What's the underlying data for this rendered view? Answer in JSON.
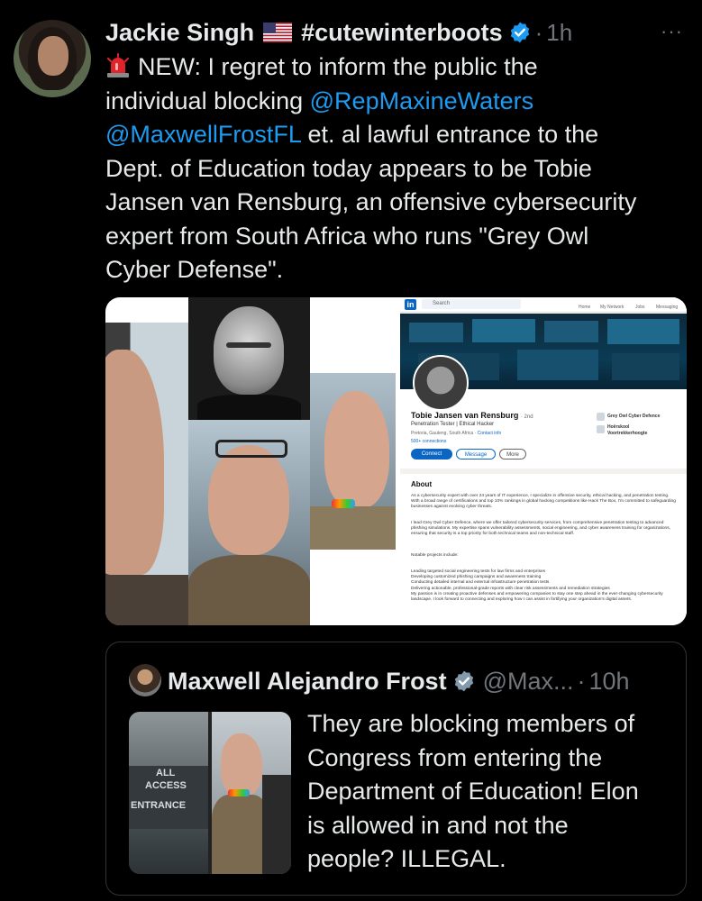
{
  "tweet": {
    "author_name": "Jackie Singh",
    "author_flag": "us-flag-icon",
    "author_hashtag": "#cutewinterboots",
    "separator": "·",
    "time": "1h",
    "more": "···",
    "text_lines": [
      {
        "pre": "NEW: I regret to inform the public the"
      },
      {
        "pre": "individual blocking ",
        "mention": "@RepMaxineWaters"
      },
      {
        "mention": "@MaxwellFrostFL",
        "post": " et. al lawful entrance to the"
      },
      {
        "pre": "Dept. of Education today appears to be Tobie"
      },
      {
        "pre": "Jansen van Rensburg, an offensive cybersecurity"
      },
      {
        "pre": "expert from South Africa who runs \"Grey Owl"
      },
      {
        "pre": "Cyber Defense\"."
      }
    ],
    "mention_color": "#1d9bf0"
  },
  "linkedin": {
    "logo": "in",
    "search_placeholder": "Search",
    "nav": [
      "Home",
      "My Network",
      "Jobs",
      "Messaging"
    ],
    "name": "Tobie Jansen van Rensburg",
    "degree": "· 2nd",
    "headline": "Penetration Tester | Ethical Hacker",
    "location": "Pretoria, Gauteng, South Africa · ",
    "contact_info": "Contact info",
    "connections": "500+ connections",
    "buttons": {
      "connect": "Connect",
      "message": "Message",
      "more": "More"
    },
    "companies": [
      "Grey Owl Cyber Defence",
      "Hoërskool",
      "Voortrekkerhoogte"
    ],
    "about_heading": "About",
    "about_paragraphs": [
      "As a cybersecurity expert with over 24 years of IT experience, I specialize in offensive security, ethical hacking, and penetration testing. With a broad range of certifications and top 10% rankings in global hacking competitions like Hack The Box, I'm committed to safeguarding businesses against evolving cyber threats.",
      "I lead Grey Owl Cyber Defence, where we offer tailored cybersecurity services, from comprehensive penetration testing to advanced phishing simulations. My expertise spans vulnerability assessments, social engineering, and cyber awareness training for organizations, ensuring that security is a top priority for both technical teams and non-technical staff.",
      "Notable projects include:",
      "Leading targeted social engineering tests for law firms and enterprises\nDeveloping customized phishing campaigns and awareness training\nConducting detailed internal and external infrastructure penetration tests\nDelivering actionable, professional-grade reports with clear risk assessments and remediation strategies\nMy passion is in creating proactive defenses and empowering companies to stay one step ahead in the ever-changing cybersecurity landscape. I look forward to connecting and exploring how I can assist in fortifying your organization's digital assets."
    ]
  },
  "quote": {
    "author_name": "Maxwell Alejandro Frost",
    "handle": "@Max...",
    "separator": "·",
    "time": "10h",
    "sign_text": [
      "ALL",
      "ACCESS",
      "ENTRANCE"
    ],
    "text_lines": [
      "They are blocking members of",
      "Congress from entering the",
      "Department of Education! Elon",
      "is allowed in and not the",
      "people? ILLEGAL."
    ]
  },
  "colors": {
    "background": "#000000",
    "text": "#e7e9ea",
    "muted": "#71767b",
    "accent": "#1d9bf0",
    "border": "#2f3336"
  }
}
